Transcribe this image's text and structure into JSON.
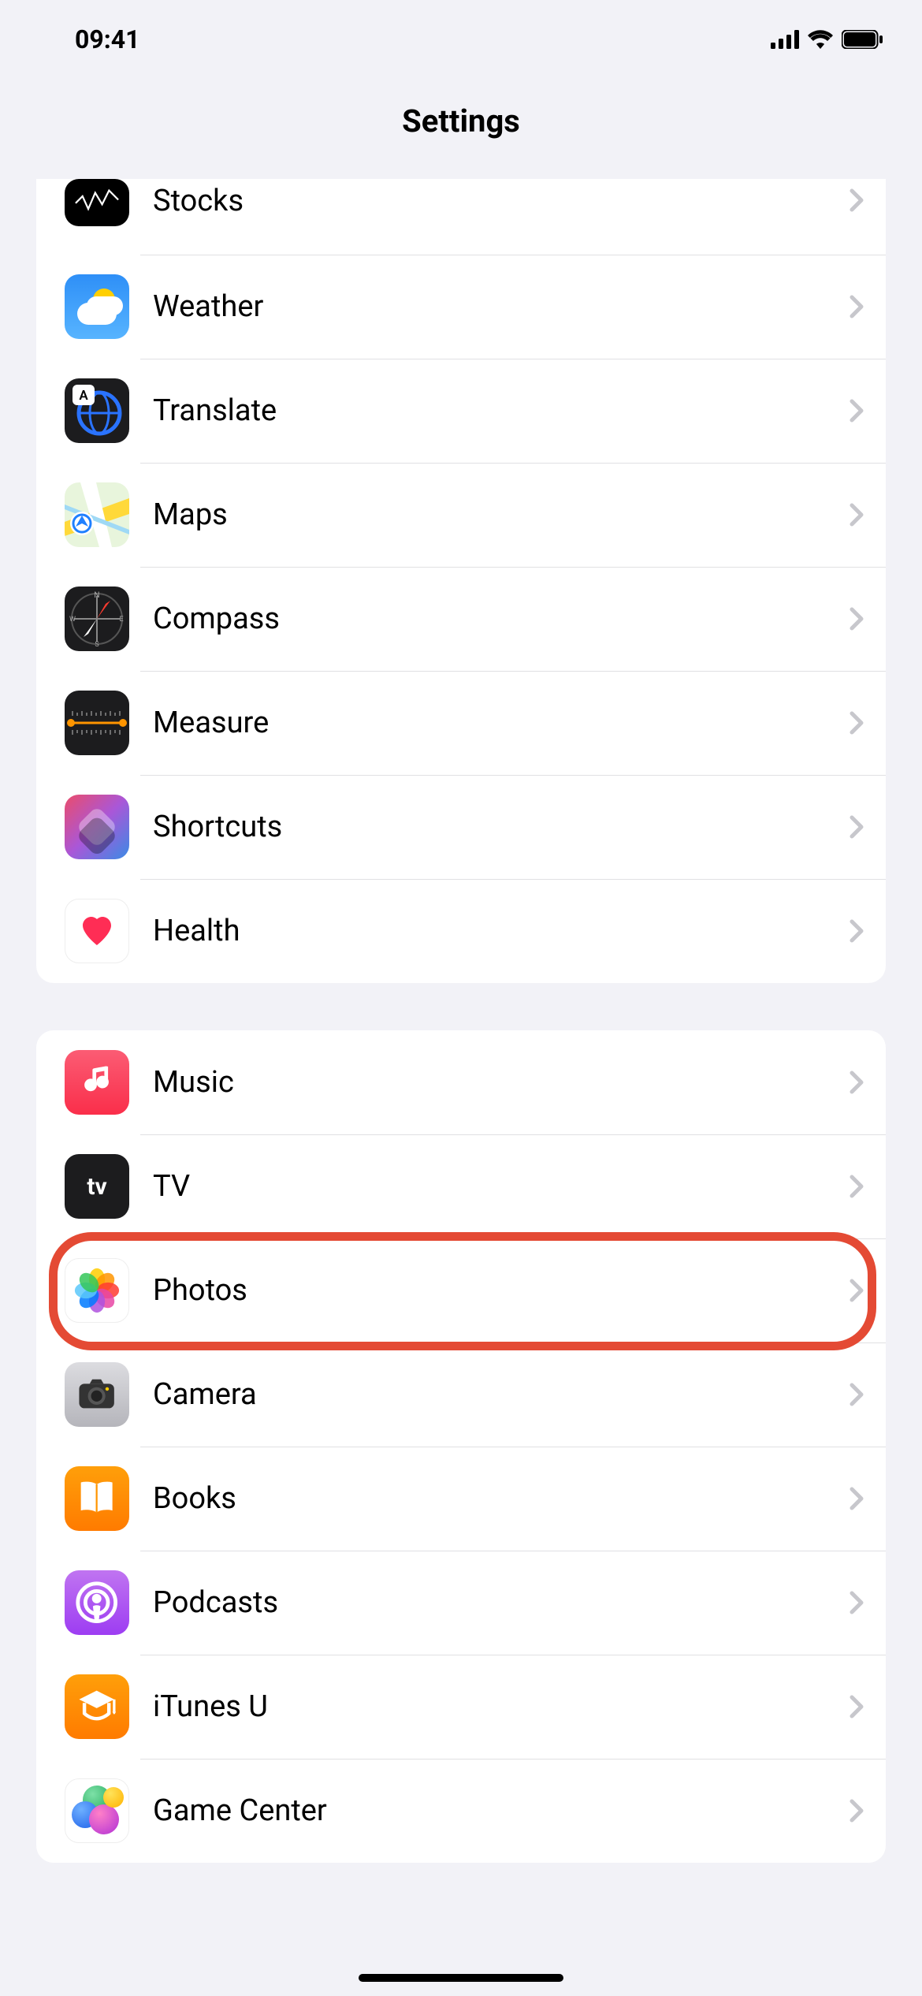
{
  "status": {
    "time": "09:41"
  },
  "header": {
    "title": "Settings"
  },
  "groups": [
    {
      "rows": [
        {
          "label": "Stocks",
          "icon": "stocks-icon"
        },
        {
          "label": "Weather",
          "icon": "weather-icon"
        },
        {
          "label": "Translate",
          "icon": "translate-icon"
        },
        {
          "label": "Maps",
          "icon": "maps-icon"
        },
        {
          "label": "Compass",
          "icon": "compass-icon"
        },
        {
          "label": "Measure",
          "icon": "measure-icon"
        },
        {
          "label": "Shortcuts",
          "icon": "shortcuts-icon"
        },
        {
          "label": "Health",
          "icon": "health-icon"
        }
      ]
    },
    {
      "rows": [
        {
          "label": "Music",
          "icon": "music-icon"
        },
        {
          "label": "TV",
          "icon": "tv-icon",
          "icon_text": "tv"
        },
        {
          "label": "Photos",
          "icon": "photos-icon",
          "highlighted": true
        },
        {
          "label": "Camera",
          "icon": "camera-icon"
        },
        {
          "label": "Books",
          "icon": "books-icon"
        },
        {
          "label": "Podcasts",
          "icon": "podcasts-icon"
        },
        {
          "label": "iTunes U",
          "icon": "itunesu-icon"
        },
        {
          "label": "Game Center",
          "icon": "gamecenter-icon"
        }
      ]
    }
  ]
}
